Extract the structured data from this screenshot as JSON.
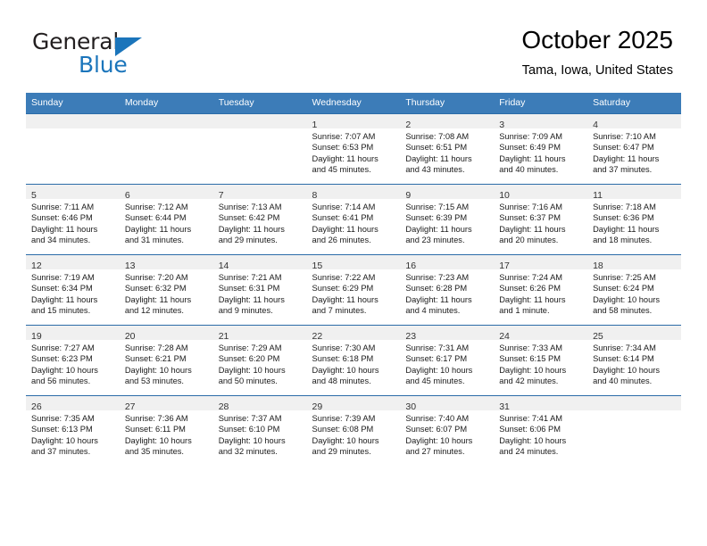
{
  "brand": {
    "name_part1": "General",
    "name_part2": "Blue",
    "accent_color": "#1b75bb"
  },
  "header": {
    "title": "October 2025",
    "location": "Tama, Iowa, United States"
  },
  "calendar": {
    "header_color": "#3c7cb8",
    "weekday_headers": [
      "Sunday",
      "Monday",
      "Tuesday",
      "Wednesday",
      "Thursday",
      "Friday",
      "Saturday"
    ],
    "weeks": [
      [
        {
          "day": "",
          "sunrise": "",
          "sunset": "",
          "daylight_line1": "",
          "daylight_line2": ""
        },
        {
          "day": "",
          "sunrise": "",
          "sunset": "",
          "daylight_line1": "",
          "daylight_line2": ""
        },
        {
          "day": "",
          "sunrise": "",
          "sunset": "",
          "daylight_line1": "",
          "daylight_line2": ""
        },
        {
          "day": "1",
          "sunrise": "Sunrise: 7:07 AM",
          "sunset": "Sunset: 6:53 PM",
          "daylight_line1": "Daylight: 11 hours",
          "daylight_line2": "and 45 minutes."
        },
        {
          "day": "2",
          "sunrise": "Sunrise: 7:08 AM",
          "sunset": "Sunset: 6:51 PM",
          "daylight_line1": "Daylight: 11 hours",
          "daylight_line2": "and 43 minutes."
        },
        {
          "day": "3",
          "sunrise": "Sunrise: 7:09 AM",
          "sunset": "Sunset: 6:49 PM",
          "daylight_line1": "Daylight: 11 hours",
          "daylight_line2": "and 40 minutes."
        },
        {
          "day": "4",
          "sunrise": "Sunrise: 7:10 AM",
          "sunset": "Sunset: 6:47 PM",
          "daylight_line1": "Daylight: 11 hours",
          "daylight_line2": "and 37 minutes."
        }
      ],
      [
        {
          "day": "5",
          "sunrise": "Sunrise: 7:11 AM",
          "sunset": "Sunset: 6:46 PM",
          "daylight_line1": "Daylight: 11 hours",
          "daylight_line2": "and 34 minutes."
        },
        {
          "day": "6",
          "sunrise": "Sunrise: 7:12 AM",
          "sunset": "Sunset: 6:44 PM",
          "daylight_line1": "Daylight: 11 hours",
          "daylight_line2": "and 31 minutes."
        },
        {
          "day": "7",
          "sunrise": "Sunrise: 7:13 AM",
          "sunset": "Sunset: 6:42 PM",
          "daylight_line1": "Daylight: 11 hours",
          "daylight_line2": "and 29 minutes."
        },
        {
          "day": "8",
          "sunrise": "Sunrise: 7:14 AM",
          "sunset": "Sunset: 6:41 PM",
          "daylight_line1": "Daylight: 11 hours",
          "daylight_line2": "and 26 minutes."
        },
        {
          "day": "9",
          "sunrise": "Sunrise: 7:15 AM",
          "sunset": "Sunset: 6:39 PM",
          "daylight_line1": "Daylight: 11 hours",
          "daylight_line2": "and 23 minutes."
        },
        {
          "day": "10",
          "sunrise": "Sunrise: 7:16 AM",
          "sunset": "Sunset: 6:37 PM",
          "daylight_line1": "Daylight: 11 hours",
          "daylight_line2": "and 20 minutes."
        },
        {
          "day": "11",
          "sunrise": "Sunrise: 7:18 AM",
          "sunset": "Sunset: 6:36 PM",
          "daylight_line1": "Daylight: 11 hours",
          "daylight_line2": "and 18 minutes."
        }
      ],
      [
        {
          "day": "12",
          "sunrise": "Sunrise: 7:19 AM",
          "sunset": "Sunset: 6:34 PM",
          "daylight_line1": "Daylight: 11 hours",
          "daylight_line2": "and 15 minutes."
        },
        {
          "day": "13",
          "sunrise": "Sunrise: 7:20 AM",
          "sunset": "Sunset: 6:32 PM",
          "daylight_line1": "Daylight: 11 hours",
          "daylight_line2": "and 12 minutes."
        },
        {
          "day": "14",
          "sunrise": "Sunrise: 7:21 AM",
          "sunset": "Sunset: 6:31 PM",
          "daylight_line1": "Daylight: 11 hours",
          "daylight_line2": "and 9 minutes."
        },
        {
          "day": "15",
          "sunrise": "Sunrise: 7:22 AM",
          "sunset": "Sunset: 6:29 PM",
          "daylight_line1": "Daylight: 11 hours",
          "daylight_line2": "and 7 minutes."
        },
        {
          "day": "16",
          "sunrise": "Sunrise: 7:23 AM",
          "sunset": "Sunset: 6:28 PM",
          "daylight_line1": "Daylight: 11 hours",
          "daylight_line2": "and 4 minutes."
        },
        {
          "day": "17",
          "sunrise": "Sunrise: 7:24 AM",
          "sunset": "Sunset: 6:26 PM",
          "daylight_line1": "Daylight: 11 hours",
          "daylight_line2": "and 1 minute."
        },
        {
          "day": "18",
          "sunrise": "Sunrise: 7:25 AM",
          "sunset": "Sunset: 6:24 PM",
          "daylight_line1": "Daylight: 10 hours",
          "daylight_line2": "and 58 minutes."
        }
      ],
      [
        {
          "day": "19",
          "sunrise": "Sunrise: 7:27 AM",
          "sunset": "Sunset: 6:23 PM",
          "daylight_line1": "Daylight: 10 hours",
          "daylight_line2": "and 56 minutes."
        },
        {
          "day": "20",
          "sunrise": "Sunrise: 7:28 AM",
          "sunset": "Sunset: 6:21 PM",
          "daylight_line1": "Daylight: 10 hours",
          "daylight_line2": "and 53 minutes."
        },
        {
          "day": "21",
          "sunrise": "Sunrise: 7:29 AM",
          "sunset": "Sunset: 6:20 PM",
          "daylight_line1": "Daylight: 10 hours",
          "daylight_line2": "and 50 minutes."
        },
        {
          "day": "22",
          "sunrise": "Sunrise: 7:30 AM",
          "sunset": "Sunset: 6:18 PM",
          "daylight_line1": "Daylight: 10 hours",
          "daylight_line2": "and 48 minutes."
        },
        {
          "day": "23",
          "sunrise": "Sunrise: 7:31 AM",
          "sunset": "Sunset: 6:17 PM",
          "daylight_line1": "Daylight: 10 hours",
          "daylight_line2": "and 45 minutes."
        },
        {
          "day": "24",
          "sunrise": "Sunrise: 7:33 AM",
          "sunset": "Sunset: 6:15 PM",
          "daylight_line1": "Daylight: 10 hours",
          "daylight_line2": "and 42 minutes."
        },
        {
          "day": "25",
          "sunrise": "Sunrise: 7:34 AM",
          "sunset": "Sunset: 6:14 PM",
          "daylight_line1": "Daylight: 10 hours",
          "daylight_line2": "and 40 minutes."
        }
      ],
      [
        {
          "day": "26",
          "sunrise": "Sunrise: 7:35 AM",
          "sunset": "Sunset: 6:13 PM",
          "daylight_line1": "Daylight: 10 hours",
          "daylight_line2": "and 37 minutes."
        },
        {
          "day": "27",
          "sunrise": "Sunrise: 7:36 AM",
          "sunset": "Sunset: 6:11 PM",
          "daylight_line1": "Daylight: 10 hours",
          "daylight_line2": "and 35 minutes."
        },
        {
          "day": "28",
          "sunrise": "Sunrise: 7:37 AM",
          "sunset": "Sunset: 6:10 PM",
          "daylight_line1": "Daylight: 10 hours",
          "daylight_line2": "and 32 minutes."
        },
        {
          "day": "29",
          "sunrise": "Sunrise: 7:39 AM",
          "sunset": "Sunset: 6:08 PM",
          "daylight_line1": "Daylight: 10 hours",
          "daylight_line2": "and 29 minutes."
        },
        {
          "day": "30",
          "sunrise": "Sunrise: 7:40 AM",
          "sunset": "Sunset: 6:07 PM",
          "daylight_line1": "Daylight: 10 hours",
          "daylight_line2": "and 27 minutes."
        },
        {
          "day": "31",
          "sunrise": "Sunrise: 7:41 AM",
          "sunset": "Sunset: 6:06 PM",
          "daylight_line1": "Daylight: 10 hours",
          "daylight_line2": "and 24 minutes."
        },
        {
          "day": "",
          "sunrise": "",
          "sunset": "",
          "daylight_line1": "",
          "daylight_line2": ""
        }
      ]
    ]
  }
}
